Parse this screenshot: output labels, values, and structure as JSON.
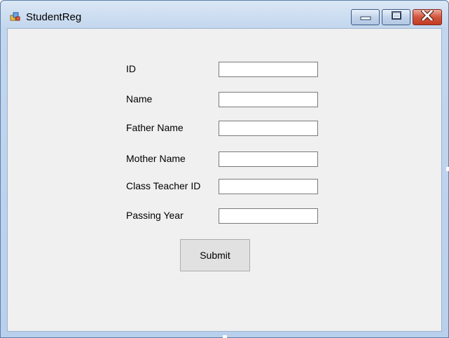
{
  "window": {
    "title": "StudentReg",
    "icon": "winforms-app-icon",
    "controls": {
      "minimize": "minimize-icon",
      "maximize": "maximize-icon",
      "close": "close-icon"
    }
  },
  "form": {
    "fields": [
      {
        "label": "ID",
        "value": ""
      },
      {
        "label": "Name",
        "value": ""
      },
      {
        "label": "Father Name",
        "value": ""
      },
      {
        "label": "Mother Name",
        "value": ""
      },
      {
        "label": "Class Teacher ID",
        "value": ""
      },
      {
        "label": "Passing Year",
        "value": ""
      }
    ],
    "submit_label": "Submit"
  },
  "colors": {
    "client_bg": "#f0f0f0",
    "frame": "#b9d0ec",
    "close_button": "#c23a22",
    "button_face": "#e1e1e1"
  }
}
